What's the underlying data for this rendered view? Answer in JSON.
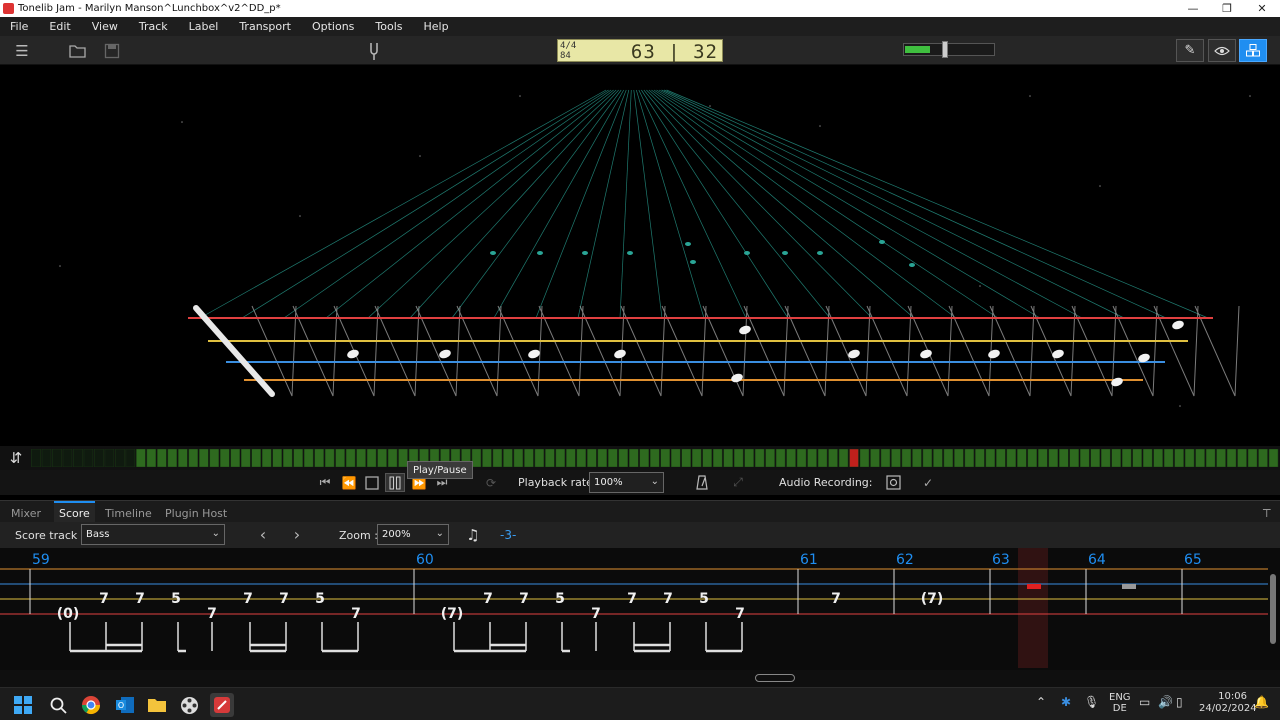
{
  "window": {
    "title": "Tonelib Jam - Marilyn Manson^Lunchbox^v2^DD_p*",
    "minimize": "—",
    "maximize": "❐",
    "close": "✕"
  },
  "menu": [
    "File",
    "Edit",
    "View",
    "Track",
    "Label",
    "Transport",
    "Options",
    "Tools",
    "Help"
  ],
  "lcd": {
    "time_signature_top": "4/4",
    "time_signature_bottom": "84",
    "position": "63 | 32"
  },
  "volume": {
    "level": 0.28
  },
  "transport": {
    "tooltip": "Play/Pause",
    "playback_rate_label": "Playback rate:",
    "playback_rate_value": "100%",
    "audio_recording_label": "Audio Recording:"
  },
  "tabs": [
    "Mixer",
    "Score",
    "Timeline",
    "Plugin Host"
  ],
  "active_tab": "Score",
  "score_controls": {
    "track_label": "Score track :",
    "track_value": "Bass",
    "zoom_label": "Zoom :",
    "zoom_value": "200%",
    "transpose": "-3-"
  },
  "score": {
    "measures": [
      "59",
      "60",
      "61",
      "62",
      "63",
      "64",
      "65"
    ],
    "notes": [
      "(0)",
      "7",
      "7",
      "5",
      "7",
      "7",
      "7",
      "5",
      "7",
      "(7)",
      "7",
      "7",
      "5",
      "7",
      "7",
      "7",
      "5",
      "7",
      "7",
      "(7)"
    ]
  },
  "progress": {
    "total_cells": 119,
    "played_start": 10,
    "current_cell": 78,
    "played_end": 118
  },
  "taskbar": {
    "lang_top": "ENG",
    "lang_bottom": "DE",
    "time": "10:06",
    "date": "24/02/2024"
  },
  "colors": {
    "accent": "#1f8ef1",
    "string_red": "#e04040",
    "string_yellow": "#e0c040",
    "string_blue": "#3a8ee0",
    "string_orange": "#e09030",
    "fret_teal": "#2aa596",
    "progress_green": "#2e6a1f",
    "playhead_red": "#c0201c"
  }
}
